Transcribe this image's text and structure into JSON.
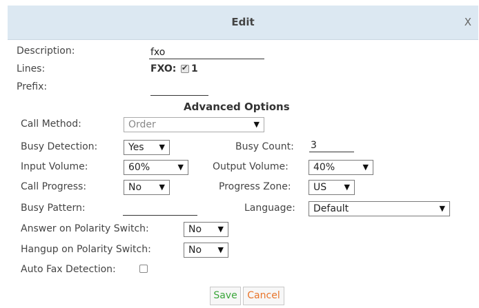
{
  "dialog": {
    "title": "Edit",
    "close_label": "X"
  },
  "basic": {
    "description_label": "Description:",
    "description_value": "fxo",
    "lines_label": "Lines:",
    "lines_port_label": "FXO:",
    "lines_checked": true,
    "lines_value": "1",
    "prefix_label": "Prefix:",
    "prefix_value": ""
  },
  "advanced": {
    "heading": "Advanced Options",
    "call_method_label": "Call Method:",
    "call_method_value": "Order",
    "busy_detection_label": "Busy Detection:",
    "busy_detection_value": "Yes",
    "busy_count_label": "Busy Count:",
    "busy_count_value": "3",
    "input_volume_label": "Input Volume:",
    "input_volume_value": "60%",
    "output_volume_label": "Output Volume:",
    "output_volume_value": "40%",
    "call_progress_label": "Call Progress:",
    "call_progress_value": "No",
    "progress_zone_label": "Progress Zone:",
    "progress_zone_value": "US",
    "busy_pattern_label": "Busy Pattern:",
    "busy_pattern_value": "",
    "language_label": "Language:",
    "language_value": "Default",
    "answer_polarity_label": "Answer on Polarity Switch:",
    "answer_polarity_value": "No",
    "hangup_polarity_label": "Hangup on Polarity Switch:",
    "hangup_polarity_value": "No",
    "auto_fax_label": "Auto Fax Detection:",
    "auto_fax_checked": false
  },
  "buttons": {
    "save_label": "Save",
    "save_color": "#3aa63a",
    "cancel_label": "Cancel",
    "cancel_color": "#e8742a"
  },
  "icons": {
    "dropdown": "chevron-down-icon",
    "checkbox": "checkbox-icon"
  },
  "colors": {
    "header_bg": "#dce8f2"
  }
}
